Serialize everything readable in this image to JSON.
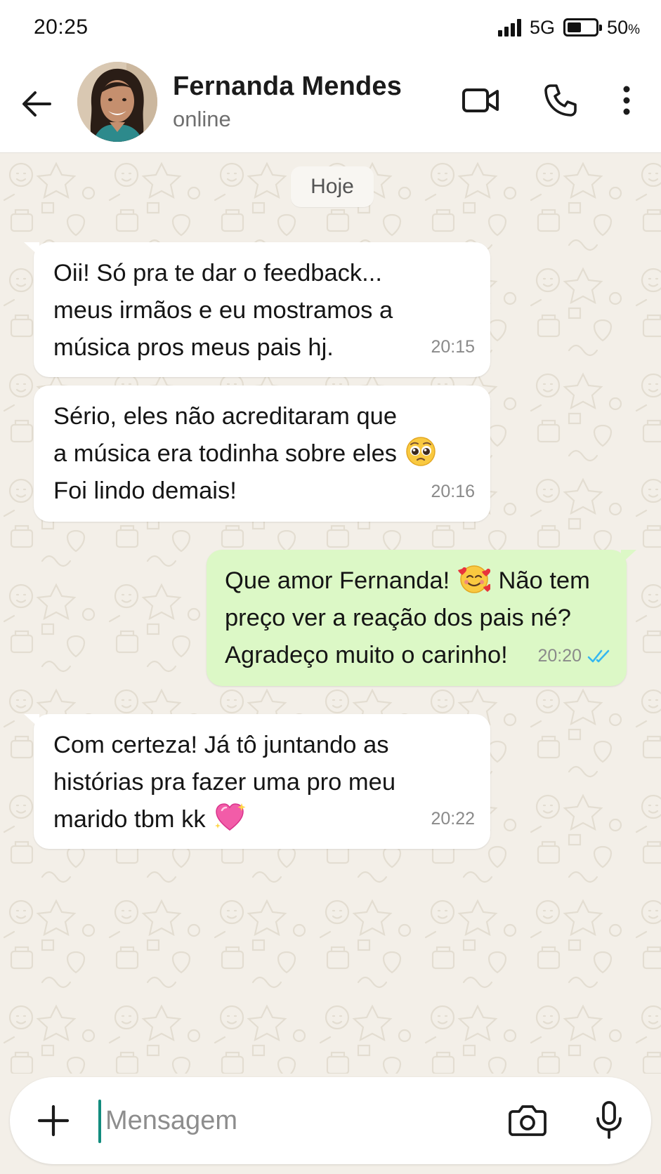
{
  "status_bar": {
    "time": "20:25",
    "network": "5G",
    "battery_percent": "50",
    "battery_unit": "%",
    "battery_level": 0.5
  },
  "header": {
    "contact_name": "Fernanda Mendes",
    "contact_status": "online",
    "icons": [
      "back-arrow-icon",
      "video-call-icon",
      "phone-icon",
      "more-vertical-icon"
    ]
  },
  "chat": {
    "date_label": "Hoje",
    "messages": [
      {
        "direction": "incoming",
        "lines": [
          "Oii! Só pra te dar o feedback...",
          "meus irmãos e eu mostramos a",
          "música pros meus pais hj."
        ],
        "time": "20:15"
      },
      {
        "direction": "incoming",
        "lines": [
          "Sério, eles não acreditaram que",
          "a música era todinha sobre eles",
          "Foi lindo demais!"
        ],
        "emoji": "pleading-face",
        "time": "20:16"
      },
      {
        "direction": "outgoing",
        "lines": [
          "Que amor Fernanda!",
          "Não tem",
          "preço ver a reação dos pais né?",
          "Agradeço muito o carinho!"
        ],
        "emoji": "smiling-face-with-hearts",
        "time": "20:20",
        "read_receipt": "double-check-blue"
      },
      {
        "direction": "incoming",
        "lines": [
          "Com certeza! Já tô juntando as",
          "histórias pra fazer uma pro meu",
          "marido tbm kk"
        ],
        "emoji": "sparkling-heart",
        "time": "20:22"
      }
    ]
  },
  "composer": {
    "placeholder": "Mensagem",
    "value": "",
    "icons": [
      "plus-icon",
      "camera-icon",
      "microphone-icon"
    ]
  },
  "colors": {
    "chat_background": "#f3efe8",
    "incoming_bubble": "#ffffff",
    "outgoing_bubble": "#dcf8c6",
    "read_receipt": "#34b7f1",
    "caret": "#128c7e"
  }
}
